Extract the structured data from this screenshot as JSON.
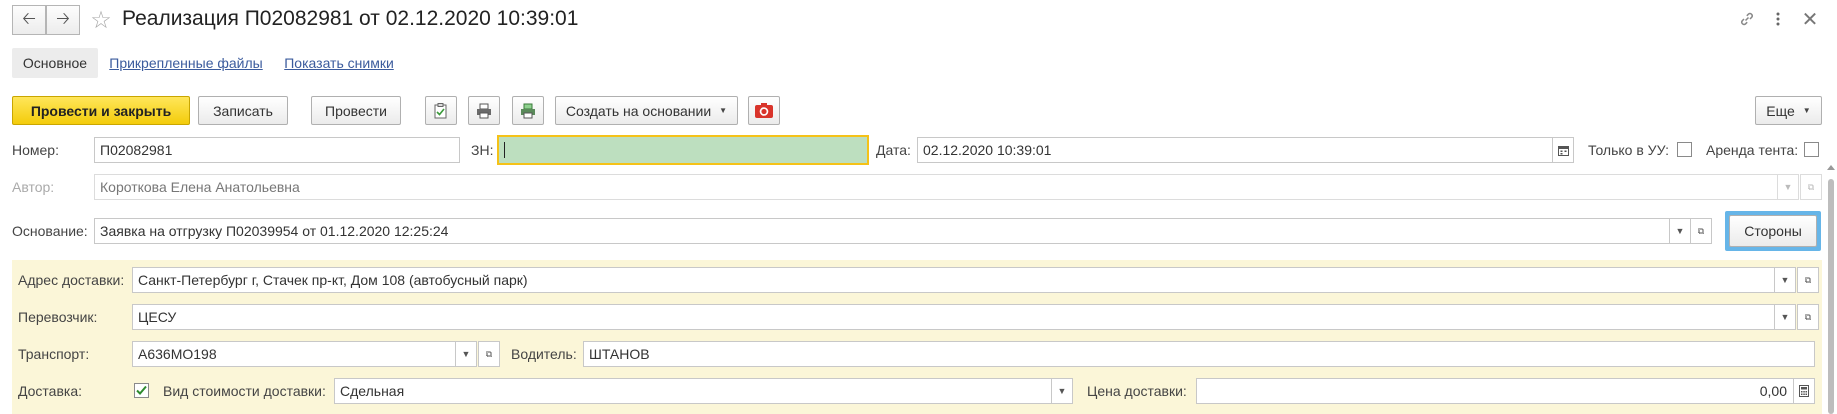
{
  "window": {
    "title": "Реализация П02082981 от 02.12.2020 10:39:01",
    "back_icon": "back-arrow-icon",
    "forward_icon": "forward-arrow-icon",
    "favorite_icon": "star-icon",
    "link_icon": "link-icon",
    "more_icon": "kebab-menu-icon",
    "close_icon": "close-icon"
  },
  "tabs": [
    {
      "label": "Основное",
      "active": true
    },
    {
      "label": "Прикрепленные файлы",
      "active": false
    },
    {
      "label": "Показать снимки",
      "active": false
    }
  ],
  "toolbar": {
    "post_close": "Провести и закрыть",
    "save": "Записать",
    "post": "Провести",
    "create_based_on": "Создать на основании",
    "more": "Еще"
  },
  "form": {
    "number_label": "Номер:",
    "number_value": "П02082981",
    "zn_label": "ЗН:",
    "zn_value": "",
    "date_label": "Дата:",
    "date_value": "02.12.2020 10:39:01",
    "only_uu_label": "Только в УУ:",
    "only_uu_checked": false,
    "tent_rent_label": "Аренда тента:",
    "tent_rent_checked": false,
    "author_label": "Автор:",
    "author_value": "Короткова Елена Анатольевна",
    "basis_label": "Основание:",
    "basis_value": "Заявка на отгрузку П02039954 от 01.12.2020 12:25:24",
    "parties_button": "Стороны"
  },
  "delivery": {
    "address_label": "Адрес доставки:",
    "address_value": "Санкт-Петербург г, Стачек пр-кт, Дом 108 (автобусный парк)",
    "carrier_label": "Перевозчик:",
    "carrier_value": "ЦЕСУ",
    "transport_label": "Транспорт:",
    "transport_value": "А636МО198",
    "driver_label": "Водитель:",
    "driver_value": "ШТАНОВ",
    "delivery_label": "Доставка:",
    "delivery_checked": true,
    "cost_type_label": "Вид стоимости доставки:",
    "cost_type_value": "Сдельная",
    "price_label": "Цена доставки:",
    "price_value": "0,00"
  },
  "colors": {
    "accent_yellow": "#f3cc0b",
    "panel_yellow": "#fbf6d8",
    "zn_field_green": "#bddfbf",
    "parties_highlight": "#66b5e8",
    "link_blue": "#3b5b9d"
  }
}
